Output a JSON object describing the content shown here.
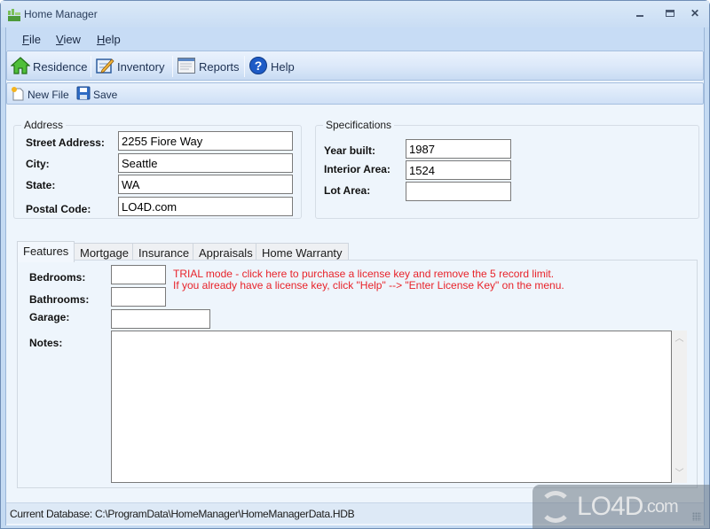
{
  "window": {
    "title": "Home Manager",
    "controls": {
      "minimize": "minimize",
      "maximize": "maximize",
      "close": "close"
    }
  },
  "menu": {
    "items": [
      {
        "label": "File",
        "accel": "F",
        "rest": "ile"
      },
      {
        "label": "View",
        "accel": "V",
        "rest": "iew"
      },
      {
        "label": "Help",
        "accel": "H",
        "rest": "elp"
      }
    ]
  },
  "toolbar": {
    "main": [
      {
        "label": "Residence",
        "icon": "house-icon"
      },
      {
        "label": "Inventory",
        "icon": "notepad-pencil-icon"
      },
      {
        "label": "Reports",
        "icon": "report-icon"
      },
      {
        "label": "Help",
        "icon": "help-icon"
      }
    ],
    "file": [
      {
        "label": "New File",
        "icon": "new-file-icon"
      },
      {
        "label": "Save",
        "icon": "save-icon"
      }
    ]
  },
  "address": {
    "title": "Address",
    "fields": [
      {
        "label": "Street Address:",
        "value": "2255 Fiore Way"
      },
      {
        "label": "City:",
        "value": "Seattle"
      },
      {
        "label": "State:",
        "value": "WA"
      },
      {
        "label": "Postal Code:",
        "value": "LO4D.com"
      }
    ]
  },
  "specifications": {
    "title": "Specifications",
    "fields": [
      {
        "label": "Year built:",
        "value": "1987"
      },
      {
        "label": "Interior Area:",
        "value": "1524"
      },
      {
        "label": "Lot Area:",
        "value": ""
      }
    ]
  },
  "tabs": {
    "items": [
      "Features",
      "Mortgage",
      "Insurance",
      "Appraisals",
      "Home Warranty"
    ],
    "active": "Features"
  },
  "features": {
    "bedrooms_label": "Bedrooms:",
    "bedrooms_value": "",
    "bathrooms_label": "Bathrooms:",
    "bathrooms_value": "",
    "garage_label": "Garage:",
    "garage_value": "",
    "notes_label": "Notes:",
    "notes_value": "",
    "trial_line1": "TRIAL mode -  click here to purchase a license key and remove the 5 record limit.",
    "trial_line2": "If you already have a license key, click \"Help\" --> \"Enter License Key\" on the menu."
  },
  "status": {
    "text": "Current Database: C:\\ProgramData\\HomeManager\\HomeManagerData.HDB"
  },
  "watermark": {
    "brand": "LO4D",
    "suffix": ".com"
  },
  "colors": {
    "trial_text": "#e8232a",
    "title_bar": "#c9ddf4",
    "panel_bg": "#eef5fc"
  }
}
